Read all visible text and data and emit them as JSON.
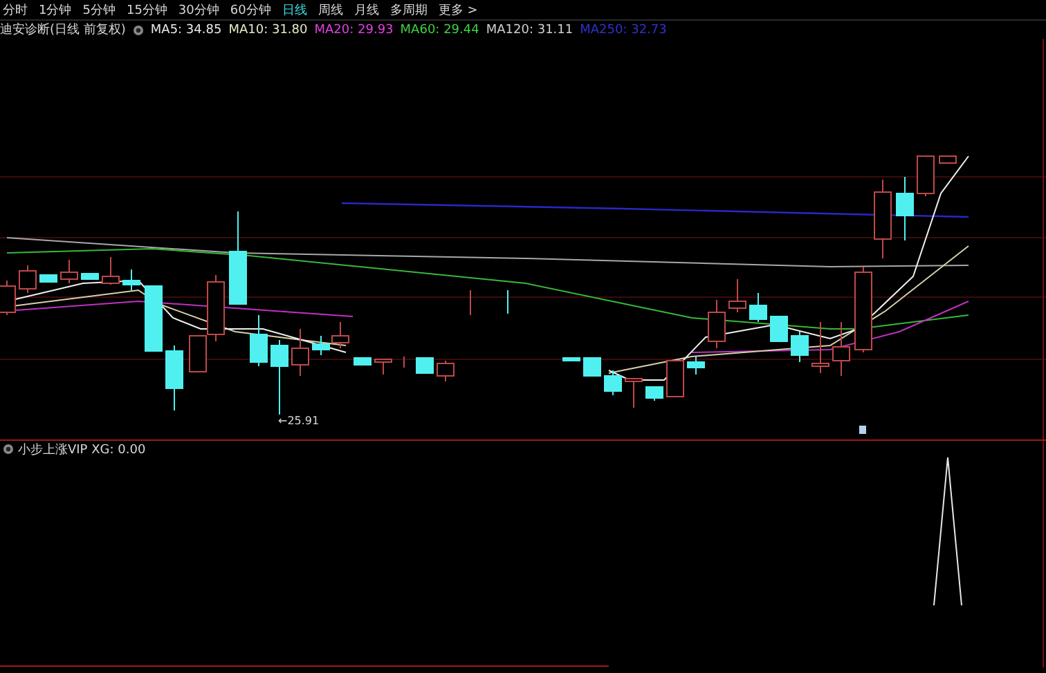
{
  "period_tabs": [
    {
      "label": "分时",
      "selected": false
    },
    {
      "label": "1分钟",
      "selected": false
    },
    {
      "label": "5分钟",
      "selected": false
    },
    {
      "label": "15分钟",
      "selected": false
    },
    {
      "label": "30分钟",
      "selected": false
    },
    {
      "label": "60分钟",
      "selected": false
    },
    {
      "label": "日线",
      "selected": true
    },
    {
      "label": "周线",
      "selected": false
    },
    {
      "label": "月线",
      "selected": false
    },
    {
      "label": "多周期",
      "selected": false
    },
    {
      "label": "更多 >",
      "selected": false
    }
  ],
  "main_chart": {
    "title": "迪安诊断(日线 前复权)",
    "ma_readings": [
      {
        "text": "MA5: 34.85",
        "color": "#e8e8e8"
      },
      {
        "text": "MA10: 31.80",
        "color": "#e8e8c8"
      },
      {
        "text": "MA20: 29.93",
        "color": "#e040e0"
      },
      {
        "text": "MA60: 29.44",
        "color": "#40d040"
      },
      {
        "text": "MA120: 31.11",
        "color": "#d0d0d0"
      },
      {
        "text": "MA250: 32.73",
        "color": "#3030d0"
      }
    ],
    "low_label": "←25.91"
  },
  "indicator": {
    "label": "小步上涨VIP XG: 0.00"
  }
}
